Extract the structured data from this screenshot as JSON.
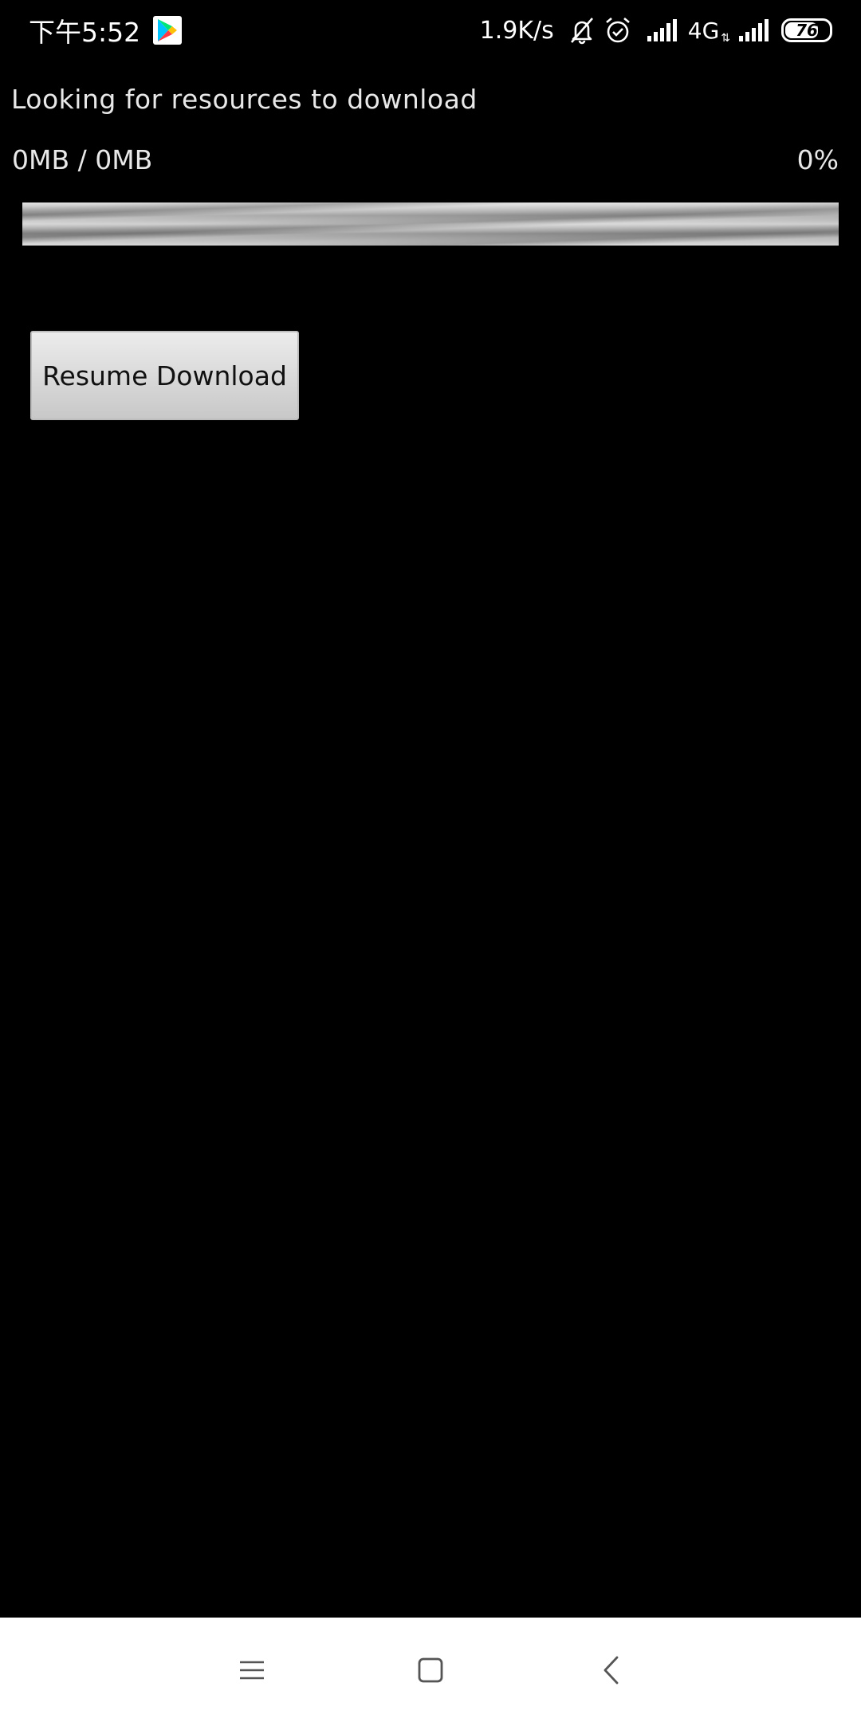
{
  "status_bar": {
    "time": "下午5:52",
    "net_speed": "1.9K/s",
    "network_type": "4G",
    "battery_level": "76",
    "icons": [
      "play-store-icon",
      "bell-off-icon",
      "alarm-icon",
      "signal-icon",
      "signal-icon"
    ]
  },
  "download": {
    "status_message": "Looking for resources to download",
    "size_readout": "0MB / 0MB",
    "percent": "0%",
    "progress_fraction": 0
  },
  "actions": {
    "resume_label": "Resume Download"
  },
  "nav": {
    "icons": [
      "menu-icon",
      "home-icon",
      "back-icon"
    ]
  },
  "colors": {
    "background": "#000000",
    "text": "#e8e8e8",
    "nav_background": "#ffffff"
  }
}
